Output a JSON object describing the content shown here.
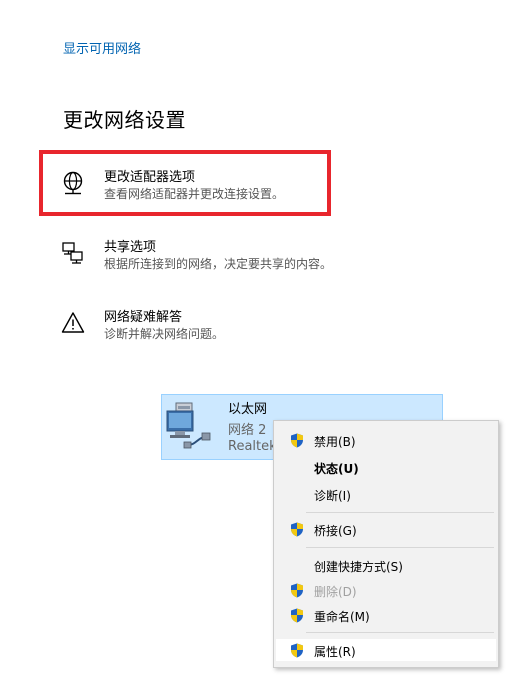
{
  "show_networks_link": "显示可用网络",
  "section_title": "更改网络设置",
  "options": [
    {
      "title": "更改适配器选项",
      "desc": "查看网络适配器并更改连接设置。",
      "icon": "adapter-globe-icon"
    },
    {
      "title": "共享选项",
      "desc": "根据所连接到的网络，决定要共享的内容。",
      "icon": "sharing-icon"
    },
    {
      "title": "网络疑难解答",
      "desc": "诊断并解决网络问题。",
      "icon": "warning-icon"
    }
  ],
  "adapter": {
    "name": "以太网",
    "network": "网络 2",
    "driver": "Realtek",
    "icon": "ethernet-computer-icon"
  },
  "context_menu": {
    "items": [
      {
        "label": "禁用(B)",
        "shield": true
      },
      {
        "label": "状态(U)",
        "bold": true
      },
      {
        "label": "诊断(I)"
      },
      {
        "label": "桥接(G)",
        "shield": true
      },
      {
        "label": "创建快捷方式(S)"
      },
      {
        "label": "删除(D)",
        "shield": true,
        "disabled": true
      },
      {
        "label": "重命名(M)",
        "shield": true
      },
      {
        "label": "属性(R)",
        "shield": true,
        "highlighted": true
      }
    ]
  },
  "colors": {
    "link": "#0063b1",
    "highlight_box": "#e8262d",
    "selection_bg": "#cce8ff",
    "menu_bg": "#f2f2f2"
  }
}
